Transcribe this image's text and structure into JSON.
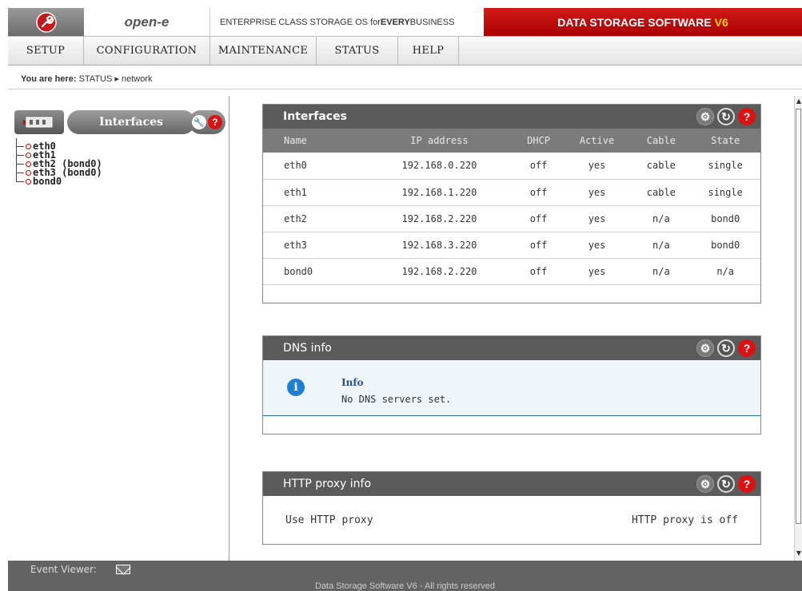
{
  "header": {
    "brand": "open-e",
    "tagline_prefix": "ENTERPRISE CLASS STORAGE OS for ",
    "tagline_bold": "EVERY",
    "tagline_suffix": " BUSINESS",
    "product": "DATA STORAGE SOFTWARE",
    "version": "V6",
    "accent": "#cc0000"
  },
  "menu": [
    "SETUP",
    "CONFIGURATION",
    "MAINTENANCE",
    "STATUS",
    "HELP"
  ],
  "breadcrumb": {
    "prefix": "You are here:",
    "path": "STATUS ▸ network"
  },
  "sidebar": {
    "tab": "Interfaces",
    "items": [
      "eth0",
      "eth1",
      "eth2 (bond0)",
      "eth3 (bond0)",
      "bond0"
    ]
  },
  "interfaces": {
    "title": "Interfaces",
    "columns": [
      "Name",
      "IP address",
      "DHCP",
      "Active",
      "Cable",
      "State"
    ],
    "rows": [
      [
        "eth0",
        "192.168.0.220",
        "off",
        "yes",
        "cable",
        "single"
      ],
      [
        "eth1",
        "192.168.1.220",
        "off",
        "yes",
        "cable",
        "single"
      ],
      [
        "eth2",
        "192.168.2.220",
        "off",
        "yes",
        "n/a",
        "bond0"
      ],
      [
        "eth3",
        "192.168.3.220",
        "off",
        "yes",
        "n/a",
        "bond0"
      ],
      [
        "bond0",
        "192.168.2.220",
        "off",
        "yes",
        "n/a",
        "n/a"
      ]
    ]
  },
  "dns": {
    "title": "DNS info",
    "info_title": "Info",
    "info_text": "No DNS servers set."
  },
  "proxy": {
    "title": "HTTP proxy info",
    "label": "Use HTTP proxy",
    "value": "HTTP proxy is off"
  },
  "footer": {
    "event_viewer": "Event Viewer:",
    "copyright": "Data Storage Software V6 - All rights reserved"
  }
}
